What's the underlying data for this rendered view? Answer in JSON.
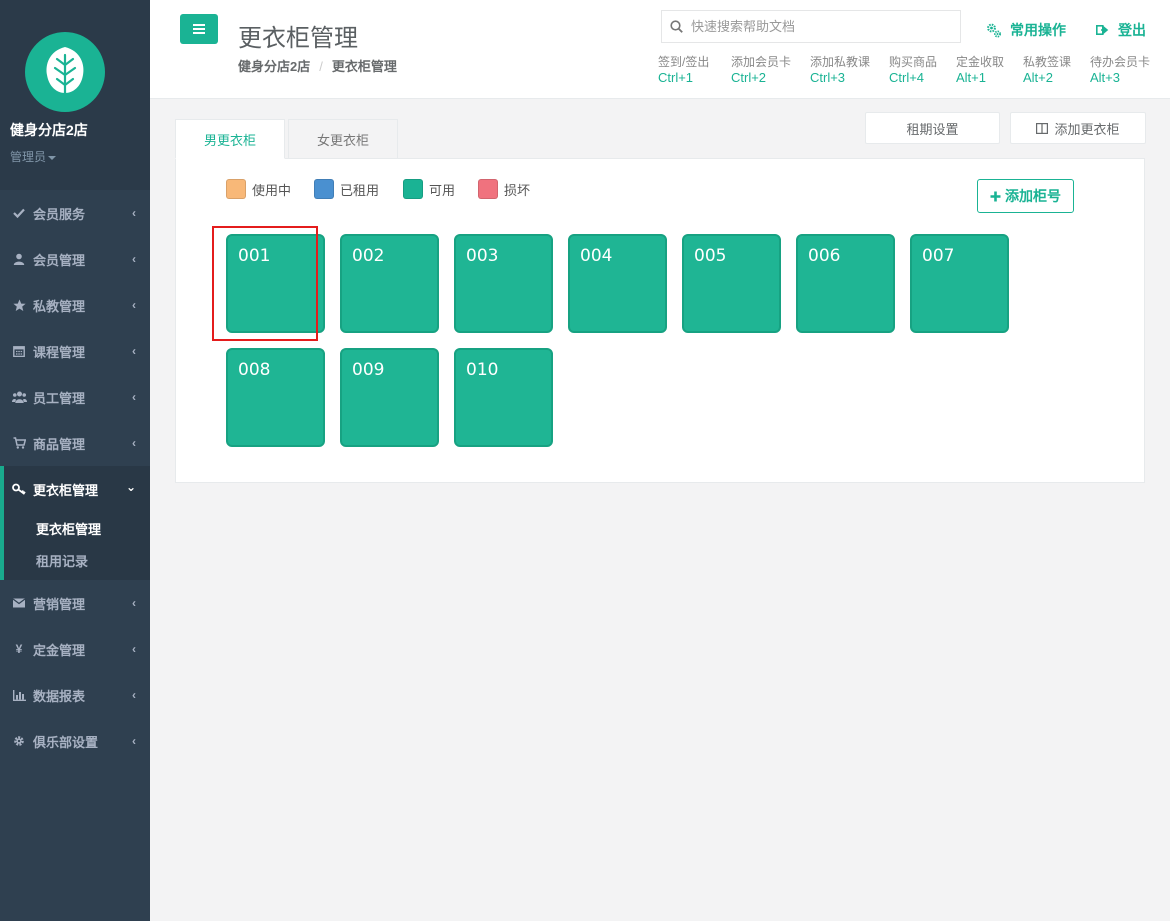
{
  "sidebar": {
    "store_name": "健身分店2店",
    "role": "管理员",
    "items": [
      {
        "label": "会员服务",
        "icon": "check-icon"
      },
      {
        "label": "会员管理",
        "icon": "user-icon"
      },
      {
        "label": "私教管理",
        "icon": "star-icon"
      },
      {
        "label": "课程管理",
        "icon": "calendar-icon"
      },
      {
        "label": "员工管理",
        "icon": "users-icon"
      },
      {
        "label": "商品管理",
        "icon": "cart-icon"
      },
      {
        "label": "更衣柜管理",
        "icon": "key-icon"
      },
      {
        "label": "营销管理",
        "icon": "envelope-icon"
      },
      {
        "label": "定金管理",
        "icon": "yen-icon"
      },
      {
        "label": "数据报表",
        "icon": "bar-chart-icon"
      },
      {
        "label": "俱乐部设置",
        "icon": "gear-icon"
      }
    ],
    "sub_items": [
      {
        "label": "更衣柜管理"
      },
      {
        "label": "租用记录"
      }
    ]
  },
  "header": {
    "title": "更衣柜管理",
    "breadcrumb": [
      "健身分店2店",
      "更衣柜管理"
    ],
    "search_placeholder": "快速搜索帮助文档",
    "common_ops": "常用操作",
    "logout": "登出",
    "shortcuts": [
      {
        "label": "签到/签出",
        "key": "Ctrl+1"
      },
      {
        "label": "添加会员卡",
        "key": "Ctrl+2"
      },
      {
        "label": "添加私教课",
        "key": "Ctrl+3"
      },
      {
        "label": "购买商品",
        "key": "Ctrl+4"
      },
      {
        "label": "定金收取",
        "key": "Alt+1"
      },
      {
        "label": "私教签课",
        "key": "Alt+2"
      },
      {
        "label": "待办会员卡",
        "key": "Alt+3"
      }
    ]
  },
  "tabs": [
    "男更衣柜",
    "女更衣柜"
  ],
  "buttons": {
    "rent_settings": "租期设置",
    "add_locker": "添加更衣柜",
    "add_number": "添加柜号"
  },
  "legend": [
    {
      "label": "使用中",
      "color": "#f8b878"
    },
    {
      "label": "已租用",
      "color": "#4a90d0"
    },
    {
      "label": "可用",
      "color": "#1ab394"
    },
    {
      "label": "损坏",
      "color": "#f0727e"
    }
  ],
  "lockers": [
    "001",
    "002",
    "003",
    "004",
    "005",
    "006",
    "007",
    "008",
    "009",
    "010"
  ],
  "colors": {
    "accent": "#1ab394",
    "sidebar": "#2f4050",
    "highlight": "#e41c1c"
  }
}
